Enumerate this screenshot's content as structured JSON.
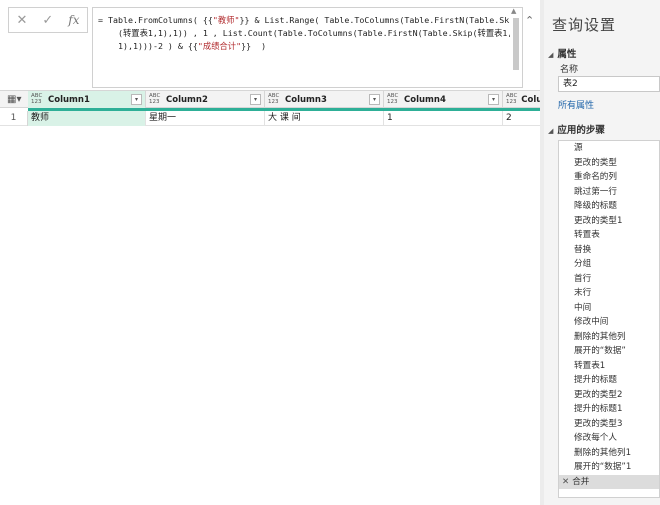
{
  "formula_controls": {
    "cancel": "✕",
    "confirm": "✓",
    "fx": "fx"
  },
  "formula": {
    "line1a": "= Table.FromColumns( {{",
    "line1_str": "\"教师\"",
    "line1b": "}} & List.Range( Table.ToColumns(Table.FirstN(Table.Skip",
    "line2": "    (转置表1,1),1)) , 1 , List.Count(Table.ToColumns(Table.FirstN(Table.Skip(转置表1,",
    "line3a": "    1),1)))-2 ) & {{",
    "line3_str": "\"成绩合计\"",
    "line3b": "}}  )"
  },
  "grid": {
    "type_label": "ABC\n123",
    "dropdown": "▾",
    "columns": [
      "Column1",
      "Column2",
      "Column3",
      "Column4",
      "Colu"
    ],
    "row_numbers": [
      "1"
    ],
    "rows": [
      [
        "教师",
        "星期一",
        "大 课 间",
        "1",
        "2"
      ]
    ]
  },
  "pane": {
    "title": "查询设置",
    "properties_header": "属性",
    "name_label": "名称",
    "name_value": "表2",
    "all_properties": "所有属性",
    "steps_header": "应用的步骤",
    "steps": [
      "源",
      "更改的类型",
      "重命名的列",
      "跳过第一行",
      "降级的标题",
      "更改的类型1",
      "转置表",
      "替换",
      "分组",
      "首行",
      "末行",
      "中间",
      "修改中间",
      "删除的其他列",
      "展开的“数据”",
      "转置表1",
      "提升的标题",
      "更改的类型2",
      "提升的标题1",
      "更改的类型3",
      "修改每个人",
      "删除的其他列1",
      "展开的“数据”1",
      "合并"
    ],
    "selected_step_icon": "✕"
  }
}
